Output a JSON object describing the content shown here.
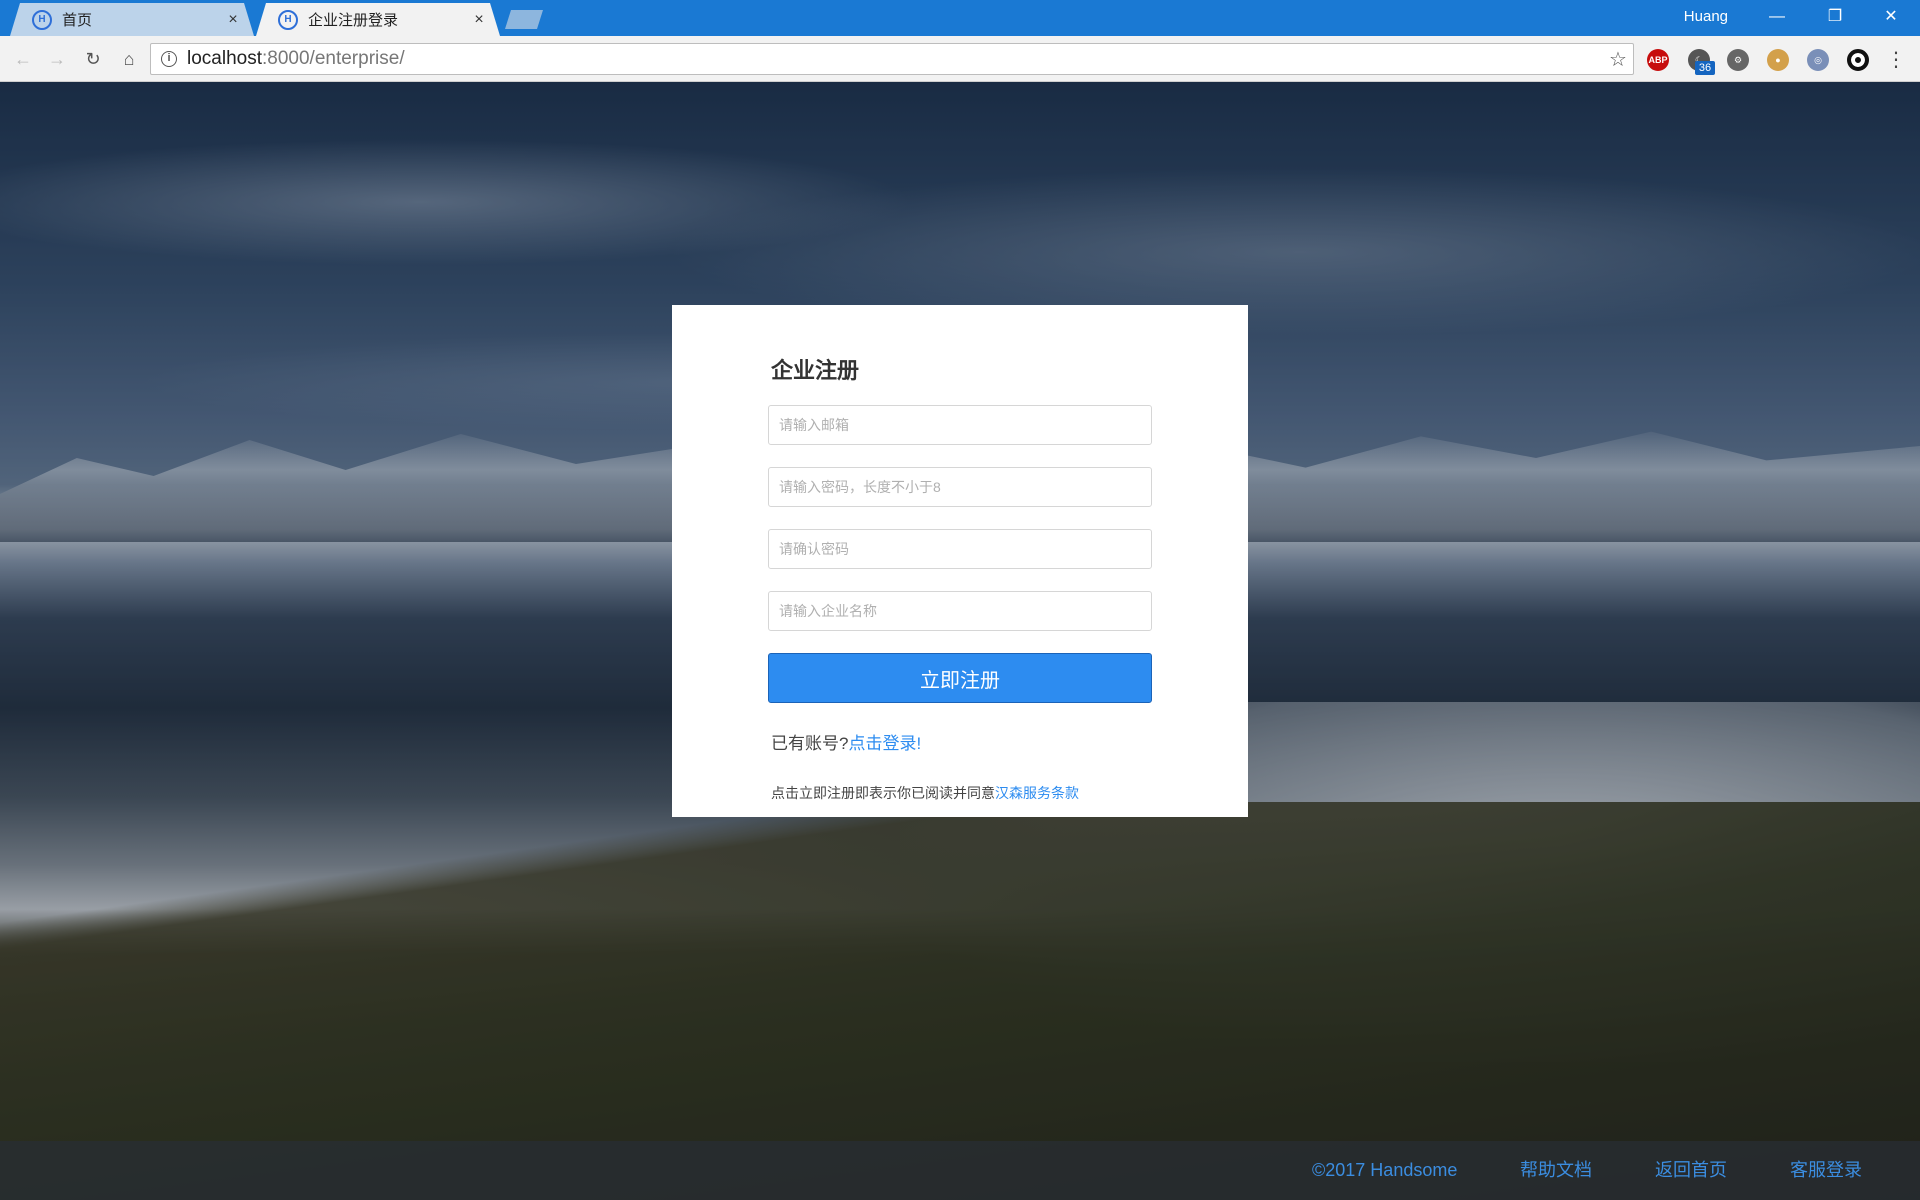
{
  "browser": {
    "tabs": [
      {
        "title": "首页",
        "active": false
      },
      {
        "title": "企业注册登录",
        "active": true
      }
    ],
    "user": "Huang",
    "url": {
      "host": "localhost",
      "rest": ":8000/enterprise/"
    },
    "extension_badge": "36",
    "icons": [
      "back-icon",
      "forward-icon",
      "reload-icon",
      "home-icon",
      "info-icon",
      "star-icon",
      "adblock-icon",
      "moon-icon",
      "gear-icon",
      "cookie-icon",
      "mask-icon",
      "ring-icon",
      "menu-icon"
    ]
  },
  "register": {
    "title": "企业注册",
    "email_placeholder": "请输入邮箱",
    "password_placeholder": "请输入密码，长度不小于8",
    "confirm_placeholder": "请确认密码",
    "company_placeholder": "请输入企业名称",
    "submit_label": "立即注册",
    "has_account_text": "已有账号?",
    "login_link": "点击登录!",
    "terms_text": "点击立即注册即表示你已阅读并同意",
    "terms_link": "汉森服务条款"
  },
  "footer": {
    "copyright": "©2017 Handsome",
    "help": "帮助文档",
    "home": "返回首页",
    "support": "客服登录"
  },
  "colors": {
    "accent": "#2d8cf0",
    "titlebar": "#1a79d3",
    "footer_link": "#3b8de0"
  }
}
